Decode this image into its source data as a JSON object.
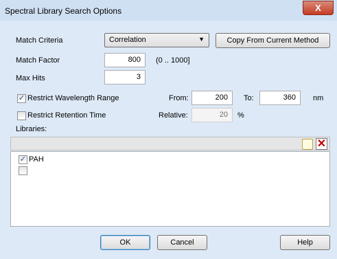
{
  "window": {
    "title": "Spectral Library Search Options",
    "close_glyph": "X"
  },
  "match_criteria": {
    "label": "Match Criteria",
    "selected": "Correlation"
  },
  "copy_button": {
    "label": "Copy From Current Method"
  },
  "match_factor": {
    "label": "Match Factor",
    "value": "800",
    "range_hint": "(0 .. 1000]"
  },
  "max_hits": {
    "label": "Max Hits",
    "value": "3"
  },
  "wavelength": {
    "label": "Restrict Wavelength Range",
    "checked": true,
    "from_label": "From:",
    "from_value": "200",
    "to_label": "To:",
    "to_value": "360",
    "unit": "nm"
  },
  "retention": {
    "label": "Restrict Retention Time",
    "checked": false,
    "relative_label": "Relative:",
    "relative_value": "20",
    "unit": "%"
  },
  "libraries": {
    "label": "Libraries:",
    "items": [
      {
        "label": "PAH",
        "checked": true
      },
      {
        "label": "",
        "checked": false
      }
    ]
  },
  "buttons": {
    "ok": "OK",
    "cancel": "Cancel",
    "help": "Help"
  },
  "icons": {
    "new": "new-item-icon",
    "delete": "delete-icon"
  }
}
